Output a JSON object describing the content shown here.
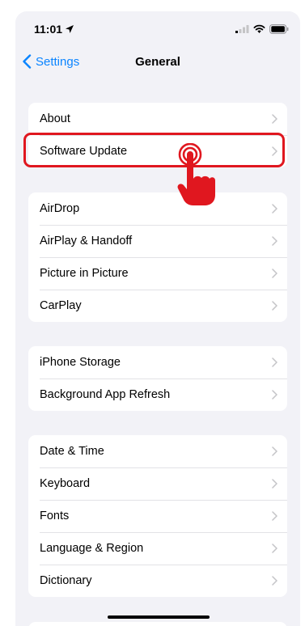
{
  "status_bar": {
    "time": "11:01"
  },
  "nav": {
    "back_label": "Settings",
    "title": "General"
  },
  "groups": [
    {
      "items": [
        {
          "label": "About"
        },
        {
          "label": "Software Update"
        }
      ]
    },
    {
      "items": [
        {
          "label": "AirDrop"
        },
        {
          "label": "AirPlay & Handoff"
        },
        {
          "label": "Picture in Picture"
        },
        {
          "label": "CarPlay"
        }
      ]
    },
    {
      "items": [
        {
          "label": "iPhone Storage"
        },
        {
          "label": "Background App Refresh"
        }
      ]
    },
    {
      "items": [
        {
          "label": "Date & Time"
        },
        {
          "label": "Keyboard"
        },
        {
          "label": "Fonts"
        },
        {
          "label": "Language & Region"
        },
        {
          "label": "Dictionary"
        }
      ]
    }
  ],
  "annotation": {
    "highlighted_item": "Software Update",
    "color": "#e0171f"
  },
  "colors": {
    "accent": "#0a84ff",
    "background": "#f2f2f7",
    "annotation": "#e0171f"
  }
}
